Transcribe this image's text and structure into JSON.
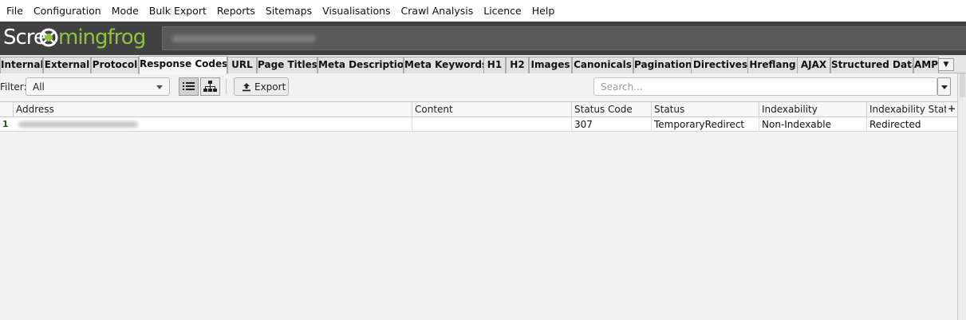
{
  "menu": [
    "File",
    "Configuration",
    "Mode",
    "Bulk Export",
    "Reports",
    "Sitemaps",
    "Visualisations",
    "Crawl Analysis",
    "Licence",
    "Help"
  ],
  "logo": {
    "part1": "Scre",
    "part2": "mingfrog"
  },
  "colors": {
    "header_bg": "#414141",
    "logo_green": "#8cc63f",
    "row_number": "#1b5e20"
  },
  "tabs": [
    {
      "label": "Internal",
      "active": false
    },
    {
      "label": "External",
      "active": false
    },
    {
      "label": "Protocol",
      "active": false
    },
    {
      "label": "Response Codes",
      "active": true
    },
    {
      "label": "URL",
      "active": false
    },
    {
      "label": "Page Titles",
      "active": false
    },
    {
      "label": "Meta Description",
      "active": false
    },
    {
      "label": "Meta Keywords",
      "active": false
    },
    {
      "label": "H1",
      "active": false
    },
    {
      "label": "H2",
      "active": false
    },
    {
      "label": "Images",
      "active": false
    },
    {
      "label": "Canonicals",
      "active": false
    },
    {
      "label": "Pagination",
      "active": false
    },
    {
      "label": "Directives",
      "active": false
    },
    {
      "label": "Hreflang",
      "active": false
    },
    {
      "label": "AJAX",
      "active": false
    },
    {
      "label": "Structured Data",
      "active": false
    },
    {
      "label": "AMP",
      "active": false
    }
  ],
  "toolbar": {
    "filter_label": "Filter:",
    "filter_value": "All",
    "export_label": "Export",
    "search_placeholder": "Search..."
  },
  "table": {
    "columns": [
      "Address",
      "Content",
      "Status Code",
      "Status",
      "Indexability",
      "Indexability Status"
    ],
    "add_column_symbol": "+",
    "rows": [
      {
        "num": "1",
        "address": "",
        "content": "",
        "status_code": "307",
        "status": "TemporaryRedirect",
        "indexability": "Non-Indexable",
        "indexability_status": "Redirected"
      }
    ]
  },
  "icons": [
    "frog-logo-icon",
    "list-view-icon",
    "tree-view-icon",
    "export-icon",
    "chevron-down-icon"
  ]
}
